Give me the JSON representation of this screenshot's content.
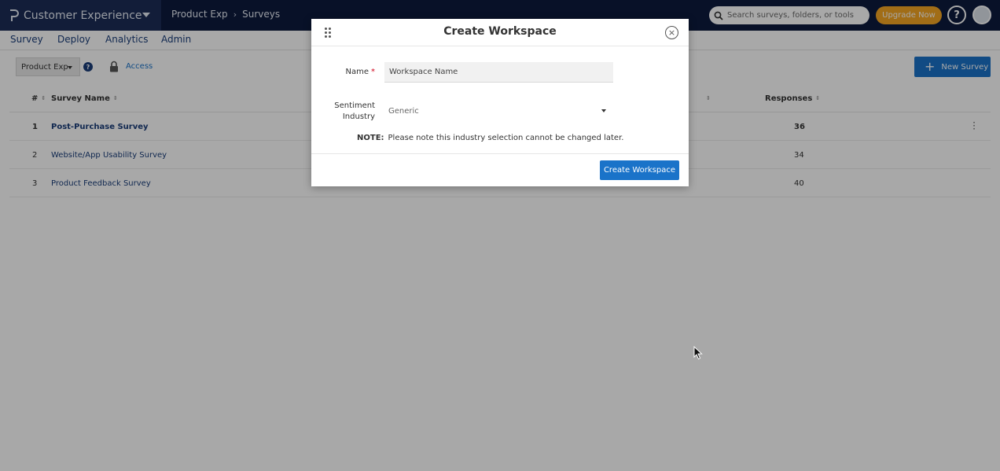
{
  "header": {
    "app_name": "Customer Experience",
    "breadcrumb": [
      "Product Exp",
      "Surveys"
    ],
    "breadcrumb_separator": "›",
    "search_placeholder": "Search surveys, folders, or tools",
    "upgrade_label": "Upgrade Now",
    "help_label": "?"
  },
  "nav": {
    "items": [
      "Survey",
      "Deploy",
      "Analytics",
      "Admin"
    ]
  },
  "toolbar": {
    "workspace_value": "Product Exp",
    "info_label": "?",
    "access_label": "Access",
    "new_survey_label": "New Survey"
  },
  "table": {
    "columns": [
      "#",
      "Survey Name",
      "Responses"
    ],
    "rows": [
      {
        "num": "1",
        "name": "Post-Purchase Survey",
        "responses": "36"
      },
      {
        "num": "2",
        "name": "Website/App Usability Survey",
        "responses": "34"
      },
      {
        "num": "3",
        "name": "Product Feedback Survey",
        "responses": "40"
      }
    ]
  },
  "modal": {
    "title": "Create Workspace",
    "close_label": "×",
    "name_label": "Name",
    "required_mark": "*",
    "name_placeholder": "Workspace Name",
    "industry_label_line1": "Sentiment",
    "industry_label_line2": "Industry",
    "industry_value": "Generic",
    "note_prefix": "NOTE:",
    "note_text": "Please note this industry selection cannot be changed later.",
    "submit_label": "Create Workspace"
  },
  "colors": {
    "topbar": "#0d1a3d",
    "brand_panel": "#1c2c57",
    "primary": "#1a73c9",
    "upgrade": "#f5a623",
    "link": "#1a3e7a"
  }
}
